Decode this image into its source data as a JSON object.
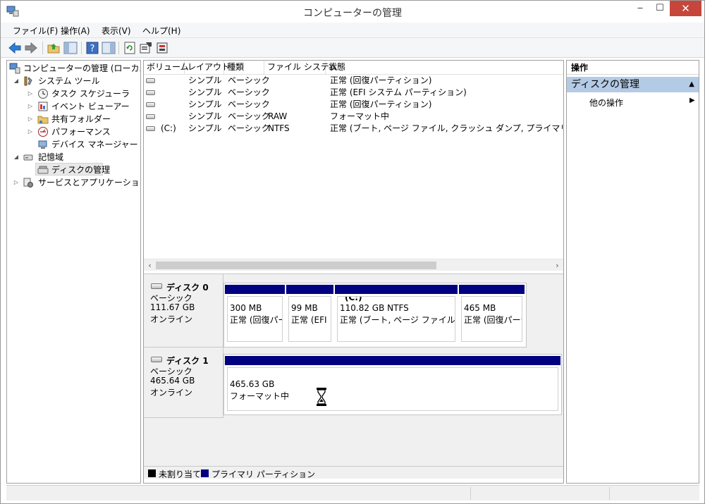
{
  "window": {
    "title": "コンピューターの管理"
  },
  "menu": {
    "file": "ファイル(F)",
    "action": "操作(A)",
    "view": "表示(V)",
    "help": "ヘルプ(H)"
  },
  "window_buttons": {
    "minimize": "‒",
    "maximize": "☐",
    "close": "✕"
  },
  "tree": {
    "root": "コンピューターの管理 (ローカル)",
    "system_tools": "システム ツール",
    "task_scheduler": "タスク スケジューラ",
    "event_viewer": "イベント ビューアー",
    "shared_folders": "共有フォルダー",
    "performance": "パフォーマンス",
    "device_manager": "デバイス マネージャー",
    "storage": "記憶域",
    "disk_management": "ディスクの管理",
    "services_apps": "サービスとアプリケーション"
  },
  "volume_table": {
    "columns": [
      "ボリューム",
      "レイアウト",
      "種類",
      "ファイル システム",
      "状態"
    ],
    "rows": [
      {
        "volume": "",
        "layout": "シンプル",
        "type": "ベーシック",
        "fs": "",
        "status": "正常 (回復パーティション)"
      },
      {
        "volume": "",
        "layout": "シンプル",
        "type": "ベーシック",
        "fs": "",
        "status": "正常 (EFI システム パーティション)"
      },
      {
        "volume": "",
        "layout": "シンプル",
        "type": "ベーシック",
        "fs": "",
        "status": "正常 (回復パーティション)"
      },
      {
        "volume": "",
        "layout": "シンプル",
        "type": "ベーシック",
        "fs": "RAW",
        "status": "フォーマット中"
      },
      {
        "volume": "(C:)",
        "layout": "シンプル",
        "type": "ベーシック",
        "fs": "NTFS",
        "status": "正常 (ブート, ページ ファイル, クラッシュ ダンプ, プライマリ パーティション"
      }
    ]
  },
  "disks": [
    {
      "name": "ディスク 0",
      "type": "ベーシック",
      "size": "111.67 GB",
      "state": "オンライン",
      "partitions": [
        {
          "title": "",
          "size": "300 MB",
          "status": "正常 (回復パーティ"
        },
        {
          "title": "",
          "size": "99 MB",
          "status": "正常 (EFI"
        },
        {
          "title": "(C:)",
          "size": "110.82 GB NTFS",
          "status": "正常 (ブート, ページ ファイル, クラ"
        },
        {
          "title": "",
          "size": "465 MB",
          "status": "正常 (回復パーテ"
        }
      ]
    },
    {
      "name": "ディスク 1",
      "type": "ベーシック",
      "size": "465.64 GB",
      "state": "オンライン",
      "partitions": [
        {
          "title": "",
          "size": "465.63 GB",
          "status": "フォーマット中"
        }
      ]
    }
  ],
  "legend": {
    "unallocated": "未割り当て",
    "primary": "プライマリ パーティション"
  },
  "actions": {
    "header": "操作",
    "section": "ディスクの管理",
    "more": "他の操作"
  },
  "colors": {
    "primary_partition": "#000080",
    "unallocated": "#000000",
    "selected_section": "#b4cbe6",
    "close_button": "#c7463b"
  }
}
